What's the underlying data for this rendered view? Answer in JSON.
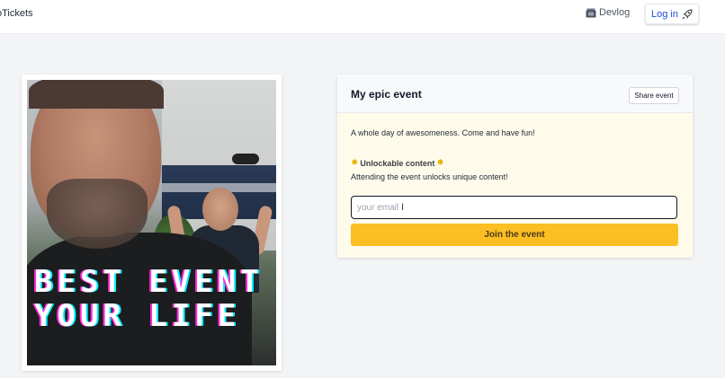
{
  "header": {
    "brand": "oTickets",
    "devlog_label": "Devlog",
    "devlog_icon": "film-clapper-icon",
    "login_label": "Log in",
    "login_icon": "rocket-icon"
  },
  "poster": {
    "line1": "BEST EVENT",
    "line2": "YOUR LIFE"
  },
  "event": {
    "title": "My epic event",
    "share_label": "Share event",
    "description": "A whole day of awesomeness. Come and have fun!",
    "unlock_title": "Unlockable content",
    "unlock_icon": "burst-icon",
    "unlock_description": "Attending the event unlocks unique content!",
    "email_placeholder": "your email",
    "email_value": "",
    "join_label": "Join the event"
  },
  "colors": {
    "accent": "#fbbf24",
    "link": "#1d4ed8",
    "card_bg": "#fffbeb",
    "page_bg": "#f3f4f6"
  }
}
